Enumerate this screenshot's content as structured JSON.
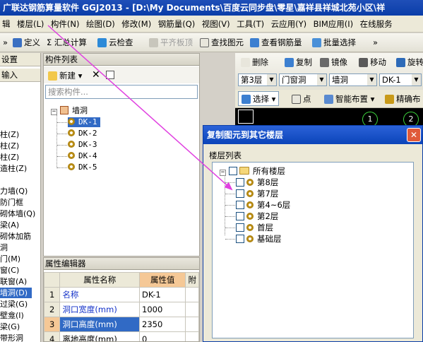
{
  "window": {
    "title": "广联达钢筋算量软件 GGJ2013 - [D:\\My Documents\\百度云同步盘\\零星\\嘉祥县祥城北苑小区\\祥"
  },
  "menu": {
    "items": [
      "楼层(L)",
      "构件(N)",
      "绘图(D)",
      "修改(M)",
      "钢筋量(Q)",
      "视图(V)",
      "工具(T)",
      "云应用(Y)",
      "BIM应用(I)",
      "在线服务"
    ],
    "lead": "辑"
  },
  "toolbar": {
    "define": "定义",
    "summary": "Σ 汇总计算",
    "cloud_check": "云检查",
    "flat_slab": "平齐板顶",
    "find": "查找图元",
    "view_rebar": "查看钢筋量",
    "batch_select": "批量选择"
  },
  "left_panel": {
    "head1": "设置",
    "head2": "输入",
    "items": [
      "柱(Z)",
      "柱(Z)",
      "柱(Z)",
      "造柱(Z)",
      "力墙(Q)",
      "防门框",
      "砌体墙(Q)",
      "梁(A)",
      "砌体加筋",
      "洞",
      "门(M)",
      "窗(C)",
      "联窗(A)",
      "墙洞(D)",
      "过梁(G)",
      "壁龛(I)",
      "梁(G)",
      "带形洞"
    ]
  },
  "component_list": {
    "title": "构件列表",
    "new_label": "新建",
    "search_placeholder": "搜索构件...",
    "root": "墙洞",
    "items": [
      "DK-1",
      "DK-2",
      "DK-3",
      "DK-4",
      "DK-5"
    ]
  },
  "property_editor": {
    "title": "属性编辑器",
    "headers": [
      "属性名称",
      "属性值",
      "附"
    ],
    "rows": [
      {
        "num": "1",
        "name": "名称",
        "value": "DK-1"
      },
      {
        "num": "2",
        "name": "洞口宽度(mm)",
        "value": "1000"
      },
      {
        "num": "3",
        "name": "洞口高度(mm)",
        "value": "2350"
      },
      {
        "num": "4",
        "name": "离地高度(mm)",
        "value": "0"
      }
    ]
  },
  "right_tools": {
    "delete": "删除",
    "copy": "复制",
    "mirror": "镜像",
    "move": "移动",
    "rotate": "旋转",
    "floor": "第3层",
    "category": "门窗洞",
    "type": "墙洞",
    "element": "DK-1",
    "select": "选择",
    "point": "点",
    "smart_place": "智能布置",
    "precise": "精确布"
  },
  "canvas": {
    "axis_labels": [
      "1",
      "2"
    ]
  },
  "dialog": {
    "title": "复制图元到其它楼层",
    "list_label": "楼层列表",
    "root": "所有楼层",
    "floors": [
      "第8层",
      "第7层",
      "第4~6层",
      "第2层",
      "首层",
      "基础层"
    ]
  },
  "colors": {
    "title_bar": "#0a3da8",
    "arrow": "#e040e0",
    "selected_row": "#316ac5",
    "header_value": "#f5c896"
  }
}
